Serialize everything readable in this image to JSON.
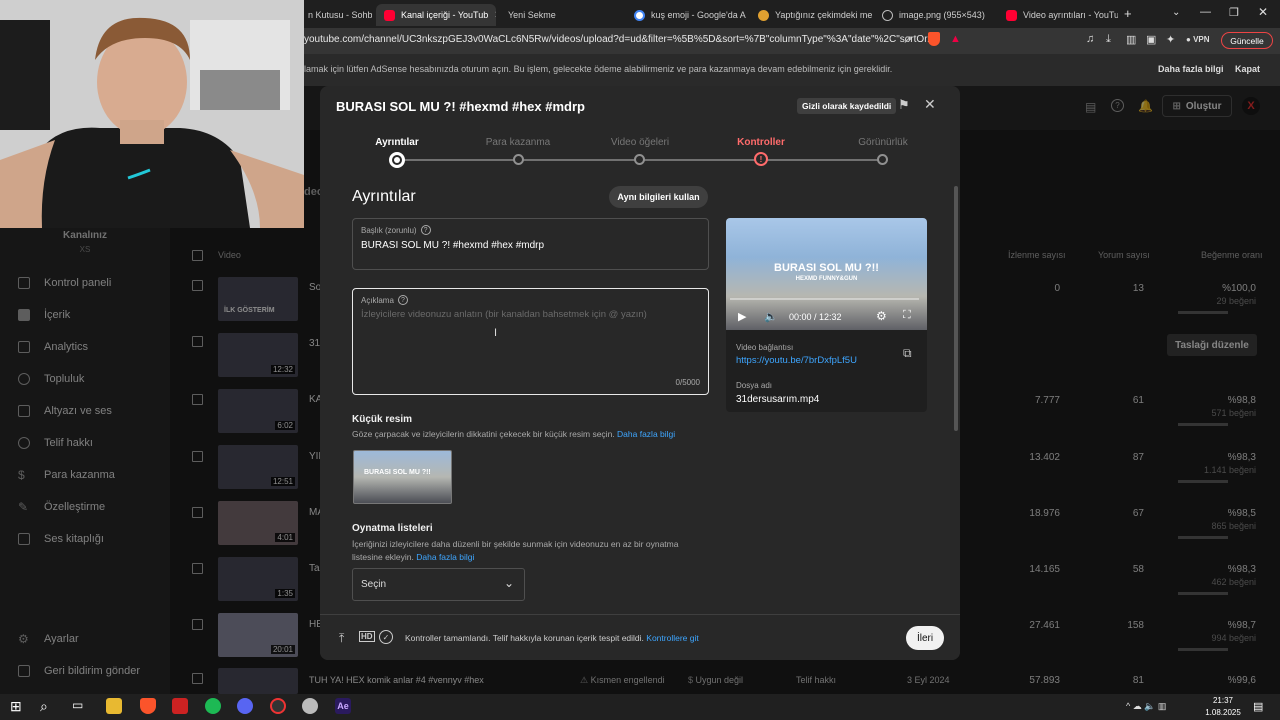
{
  "browser": {
    "tabs": [
      {
        "label": "n Kutusu - Sohbe"
      },
      {
        "label": "Kanal içeriği - YouTub"
      },
      {
        "label": "Yeni Sekme"
      },
      {
        "label": "kuş emoji - Google'da Ara"
      },
      {
        "label": "Yaptığınız çekimdeki met"
      },
      {
        "label": "image.png (955×543)"
      },
      {
        "label": "Video ayrıntıları - YouTub"
      }
    ],
    "url": "youtube.com/channel/UC3nkszpGEJ3v0WaCLc6N5Rw/videos/upload?d=ud&filter=%5B%5D&sort=%7B\"columnType\"%3A\"date\"%2C\"sortOr...",
    "vpn_label": "VPN",
    "update_label": "Güncelle"
  },
  "infobar": {
    "text": "lamak için lütfen AdSense hesabınızda oturum açın. Bu işlem, gelecekte ödeme alabilirmeniz ve para kazanmaya devam edebilmeniz için gereklidir.",
    "more_label": "Daha fazla bilgi",
    "close_label": "Kapat"
  },
  "header": {
    "create_label": "Oluştur"
  },
  "sidebar": {
    "channel_label": "Kanalınız",
    "channel_name": "XS",
    "items": [
      {
        "label": "Kontrol paneli"
      },
      {
        "label": "İçerik"
      },
      {
        "label": "Analytics"
      },
      {
        "label": "Topluluk"
      },
      {
        "label": "Altyazı ve ses"
      },
      {
        "label": "Telif hakkı"
      },
      {
        "label": "Para kazanma"
      },
      {
        "label": "Özelleştirme"
      },
      {
        "label": "Ses kitaplığı"
      }
    ],
    "bottom_items": [
      {
        "label": "Ayarlar"
      },
      {
        "label": "Geri bildirim gönder"
      }
    ]
  },
  "table": {
    "tab_partial": "deol",
    "columns": {
      "video": "Video",
      "views": "İzlenme sayısı",
      "comments": "Yorum sayısı",
      "likes": "Beğenme oranı"
    },
    "draft_button": "Taslağı düzenle",
    "rows": [
      {
        "title": "So",
        "duration": "",
        "thumb_text": "İLK GÖSTERİM",
        "views": "0",
        "comments": "13",
        "likes": "%100,0",
        "likes_sub": "29 beğeni"
      },
      {
        "title": "31",
        "duration": "12:32",
        "views": "",
        "comments": "",
        "likes": "",
        "likes_sub": ""
      },
      {
        "title": "KA",
        "duration": "6:02",
        "views": "7.777",
        "comments": "61",
        "likes": "%98,8",
        "likes_sub": "571 beğeni"
      },
      {
        "title": "YIL",
        "duration": "12:51",
        "views": "13.402",
        "comments": "87",
        "likes": "%98,3",
        "likes_sub": "1.141 beğeni"
      },
      {
        "title": "MA",
        "duration": "4:01",
        "views": "18.976",
        "comments": "67",
        "likes": "%98,5",
        "likes_sub": "865 beğeni"
      },
      {
        "title": "Tar",
        "duration": "1:35",
        "views": "14.165",
        "comments": "58",
        "likes": "%98,3",
        "likes_sub": "462 beğeni"
      },
      {
        "title": "HE",
        "duration": "20:01",
        "views": "27.461",
        "comments": "158",
        "likes": "%98,7",
        "likes_sub": "994 beğeni"
      },
      {
        "title": "TUH YA! HEX komik anlar #4 #vennyv #hex",
        "duration": "",
        "views": "57.893",
        "comments": "81",
        "likes": "%99,6",
        "likes_sub": "",
        "restriction": "Kısmen engellendi",
        "monetization": "Uygun değil",
        "claim": "Telif hakkı",
        "date": "3 Eyl 2024"
      }
    ]
  },
  "modal": {
    "title": "BURASI SOL MU ?! #hexmd #hex #mdrp",
    "saved_badge": "Gizli olarak kaydedildi",
    "steps": [
      {
        "label": "Ayrıntılar",
        "state": "active"
      },
      {
        "label": "Para kazanma",
        "state": "todo"
      },
      {
        "label": "Video öğeleri",
        "state": "todo"
      },
      {
        "label": "Kontroller",
        "state": "warning"
      },
      {
        "label": "Görünürlük",
        "state": "todo"
      }
    ],
    "section_heading": "Ayrıntılar",
    "reuse_button": "Aynı bilgileri kullan",
    "title_field": {
      "label": "Başlık (zorunlu)",
      "value": "BURASI SOL MU ?!  #hexmd #hex #mdrp"
    },
    "description_field": {
      "label": "Açıklama",
      "placeholder": "İzleyicilere videonuzu anlatın (bir kanaldan bahsetmek için @ yazın)",
      "counter": "0/5000"
    },
    "thumbnail": {
      "heading": "Küçük resim",
      "description": "Göze çarpacak ve izleyicilerin dikkatini çekecek bir küçük resim seçin.",
      "link": "Daha fazla bilgi"
    },
    "playlists": {
      "heading": "Oynatma listeleri",
      "description": "İçeriğinizi izleyicilere daha düzenli bir şekilde sunmak için videonuzu en az bir oynatma listesine ekleyin.",
      "link": "Daha fazla bilgi",
      "select_value": "Seçin"
    },
    "preview": {
      "overlay_title": "BURASI SOL MU ?!!",
      "overlay_sub": "HEXMD FUNNY&GUN",
      "time": "00:00 / 12:32",
      "link_label": "Video bağlantısı",
      "link": "https://youtu.be/7brDxfpLf5U",
      "file_label": "Dosya adı",
      "file_name": "31dersusarım.mp4"
    },
    "footer": {
      "status": "Kontroller tamamlandı. Telif hakkıyla korunan içerik tespit edildi.",
      "link": "Kontrollere git",
      "next_button": "İleri"
    }
  },
  "taskbar": {
    "time": "21:37",
    "date": "1.08.2025"
  }
}
